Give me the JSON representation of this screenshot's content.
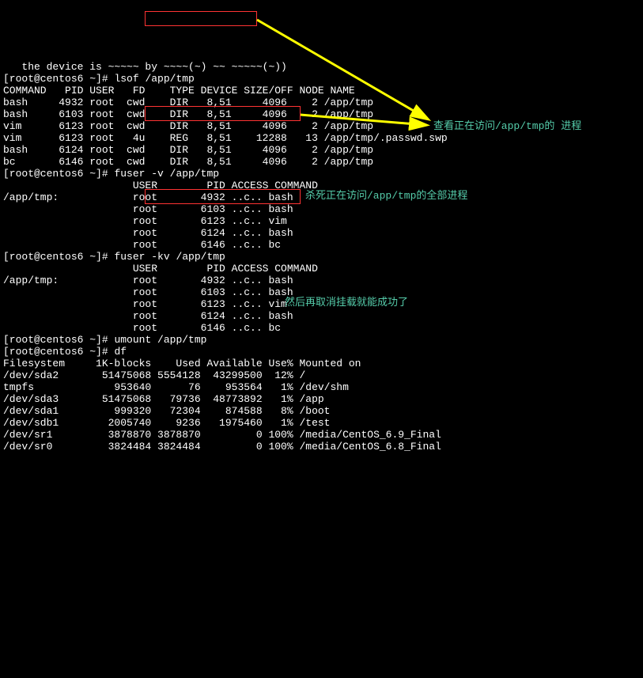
{
  "top_fragment": "   the device is ~~~~~ by ~~~~(~) ~~ ~~~~~(~))",
  "prompt": "[root@centos6 ~]# ",
  "cmds": {
    "lsof": "lsof /app/tmp",
    "fuser_v": "fuser -v /app/tmp",
    "fuser_kv": "fuser -kv /app/tmp",
    "umount": "umount /app/tmp",
    "df": "df"
  },
  "lsof_header": "COMMAND   PID USER   FD    TYPE DEVICE SIZE/OFF NODE NAME",
  "lsof_rows": [
    "bash     4932 root  cwd    DIR   8,51     4096    2 /app/tmp",
    "bash     6103 root  cwd    DIR   8,51     4096    2 /app/tmp",
    "vim      6123 root  cwd    DIR   8,51     4096    2 /app/tmp",
    "vim      6123 root   4u    REG   8,51    12288   13 /app/tmp/.passwd.swp",
    "bash     6124 root  cwd    DIR   8,51     4096    2 /app/tmp",
    "bc       6146 root  cwd    DIR   8,51     4096    2 /app/tmp"
  ],
  "fuser_header": "                     USER        PID ACCESS COMMAND",
  "fuser_path_label": "/app/tmp:",
  "fuser_rows": [
    "            root       4932 ..c.. bash",
    "                     root       6103 ..c.. bash",
    "                     root       6123 ..c.. vim",
    "                     root       6124 ..c.. bash",
    "                     root       6146 ..c.. bc"
  ],
  "df_header": "Filesystem     1K-blocks    Used Available Use% Mounted on",
  "df_rows": [
    "/dev/sda2       51475068 5554128  43299500  12% /",
    "tmpfs             953640      76    953564   1% /dev/shm",
    "/dev/sda3       51475068   79736  48773892   1% /app",
    "/dev/sda1         999320   72304    874588   8% /boot",
    "/dev/sdb1        2005740    9236   1975460   1% /test",
    "/dev/sr1         3878870 3878870         0 100% /media/CentOS_6.9_Final",
    "/dev/sr0         3824484 3824484         0 100% /media/CentOS_6.8_Final"
  ],
  "notes": {
    "n1": "查看正在访问/app/tmp的 进程",
    "n2": "杀死正在访问/app/tmp的全部进程",
    "n3": "然后再取消挂载就能成功了"
  }
}
